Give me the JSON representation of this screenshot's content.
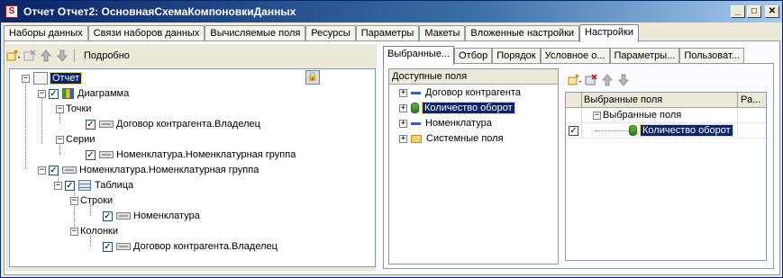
{
  "window": {
    "title": "Отчет Отчет2: ОсновнаяСхемаКомпоновкиДанных",
    "app_icon": "1c-app-icon",
    "controls": [
      "minimize",
      "maximize",
      "close"
    ]
  },
  "main_tabs": [
    {
      "label": "Наборы данных",
      "active": false
    },
    {
      "label": "Связи наборов данных",
      "active": false
    },
    {
      "label": "Вычисляемые поля",
      "active": false
    },
    {
      "label": "Ресурсы",
      "active": false
    },
    {
      "label": "Параметры",
      "active": false
    },
    {
      "label": "Макеты",
      "active": false
    },
    {
      "label": "Вложенные настройки",
      "active": false
    },
    {
      "label": "Настройки",
      "active": true
    }
  ],
  "structure_toolbar": {
    "detail_label": "Подробно",
    "icons": [
      "add-icon",
      "delete-icon",
      "move-up-icon",
      "move-down-icon"
    ]
  },
  "structure_tree": {
    "root": "Отчет",
    "chart": "Диаграмма",
    "points": "Точки",
    "points_field": "Договор контрагента.Владелец",
    "series": "Серии",
    "series_field": "Номенклатура.Номенклатурная группа",
    "grouping": "Номенклатура.Номенклатурная группа",
    "table": "Таблица",
    "rows": "Строки",
    "rows_field": "Номенклатура",
    "columns": "Колонки",
    "columns_field": "Договор контрагента.Владелец"
  },
  "settings_tabs": [
    {
      "label": "Выбранные...",
      "active": true
    },
    {
      "label": "Отбор",
      "active": false
    },
    {
      "label": "Порядок",
      "active": false
    },
    {
      "label": "Условное о...",
      "active": false
    },
    {
      "label": "Параметры...",
      "active": false
    },
    {
      "label": "Пользоват...",
      "active": false
    }
  ],
  "available_fields": {
    "header": "Доступные поля",
    "items": [
      {
        "label": "Договор контрагента",
        "icon": "field-dash-icon",
        "selected": false
      },
      {
        "label": "Количество оборот",
        "icon": "resource-icon",
        "selected": true
      },
      {
        "label": "Номенклатура",
        "icon": "field-dash-icon",
        "selected": false
      },
      {
        "label": "Системные поля",
        "icon": "folder-icon",
        "selected": false
      }
    ]
  },
  "selected_fields": {
    "col_selected": "Выбранные поля",
    "col_layout": "Ра...",
    "group_label": "Выбранные поля",
    "item_label": "Количество оборот"
  }
}
